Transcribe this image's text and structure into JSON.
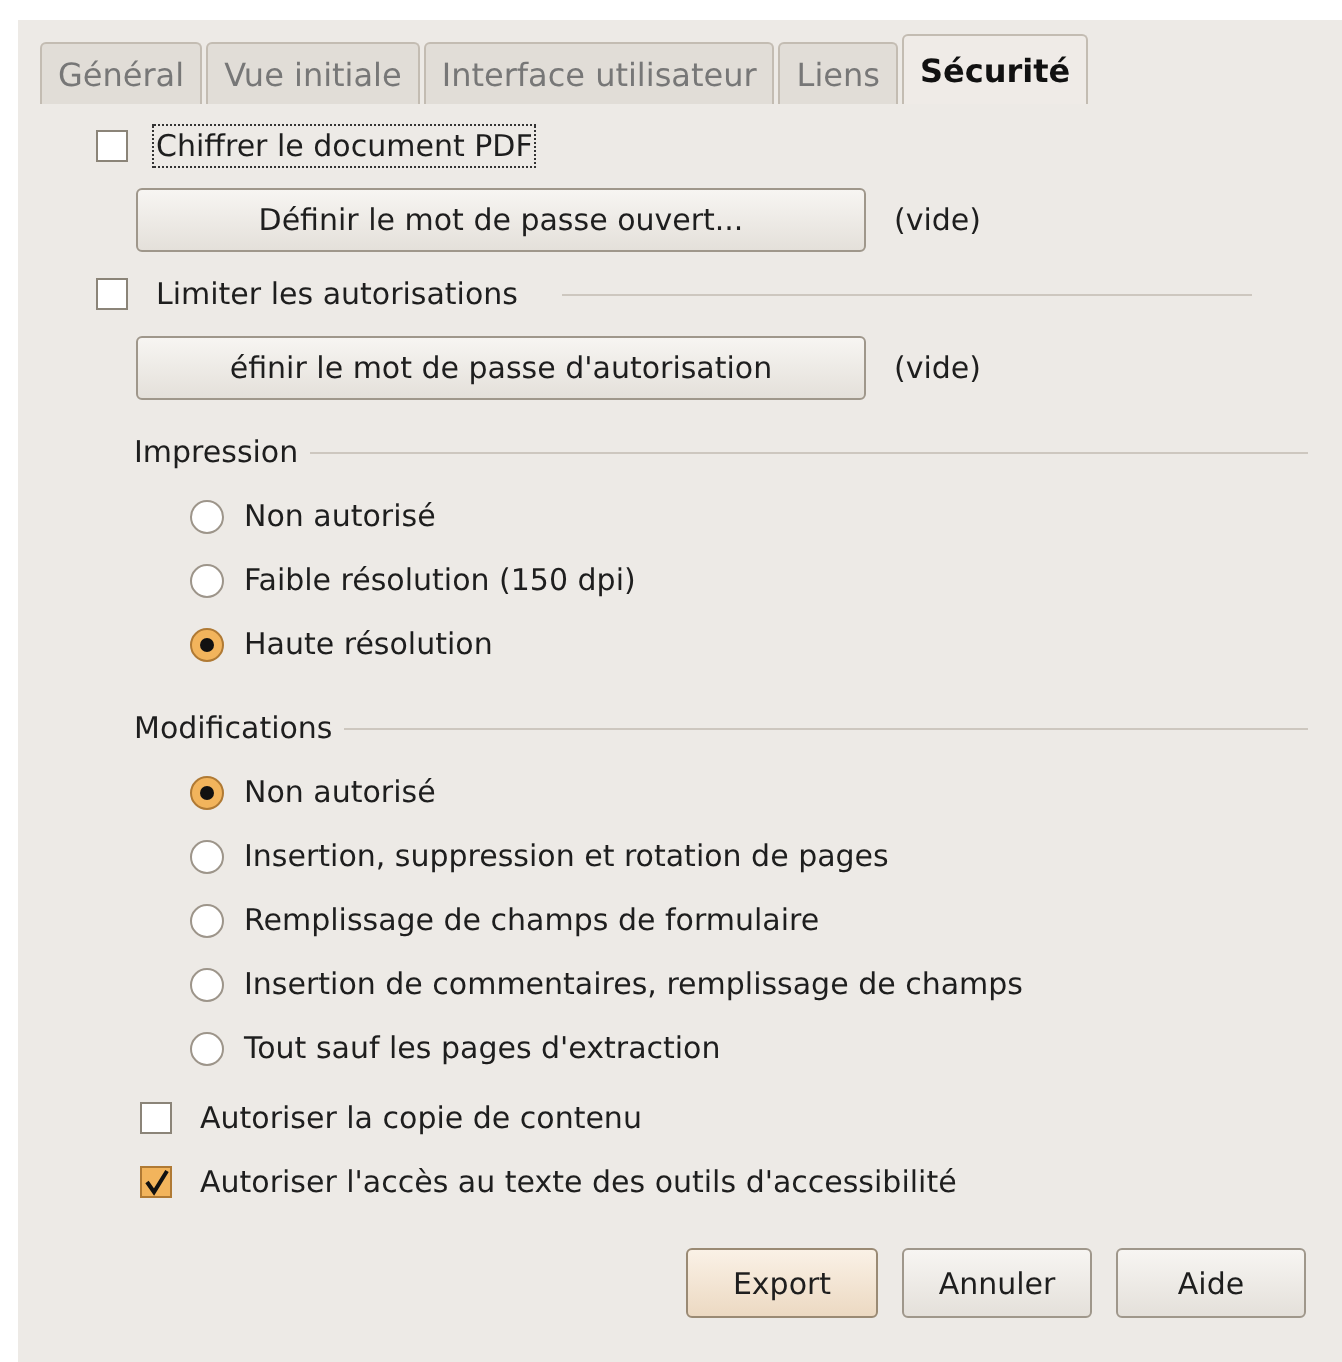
{
  "tabs": [
    {
      "label": "Général",
      "selected": false
    },
    {
      "label": "Vue initiale",
      "selected": false
    },
    {
      "label": "Interface utilisateur",
      "selected": false
    },
    {
      "label": "Liens",
      "selected": false
    },
    {
      "label": "Sécurité",
      "selected": true
    }
  ],
  "encrypt": {
    "label": "Chiffrer le document PDF",
    "checked": false,
    "focused": true,
    "button": "Définir le mot de passe ouvert...",
    "status": "(vide)"
  },
  "permissions": {
    "label": "Limiter les autorisations",
    "checked": false,
    "focused": false,
    "button": "éfinir le mot de passe d'autorisation",
    "status": "(vide)"
  },
  "groups": [
    {
      "heading": "Impression",
      "options": [
        {
          "label": "Non autorisé",
          "selected": false
        },
        {
          "label": "Faible résolution (150 dpi)",
          "selected": false
        },
        {
          "label": "Haute résolution",
          "selected": true
        }
      ]
    },
    {
      "heading": "Modifications",
      "options": [
        {
          "label": "Non autorisé",
          "selected": true
        },
        {
          "label": "Insertion, suppression et rotation de pages",
          "selected": false
        },
        {
          "label": "Remplissage de champs de formulaire",
          "selected": false
        },
        {
          "label": "Insertion de commentaires, remplissage de champs",
          "selected": false
        },
        {
          "label": "Tout sauf les pages d'extraction",
          "selected": false
        }
      ]
    }
  ],
  "extra_options": [
    {
      "label": "Autoriser la copie de contenu",
      "checked": false
    },
    {
      "label": "Autoriser l'accès au texte des outils d'accessibilité",
      "checked": true
    }
  ],
  "buttons": [
    {
      "label": "Export",
      "default": true
    },
    {
      "label": "Annuler",
      "default": false
    },
    {
      "label": "Aide",
      "default": false
    }
  ]
}
